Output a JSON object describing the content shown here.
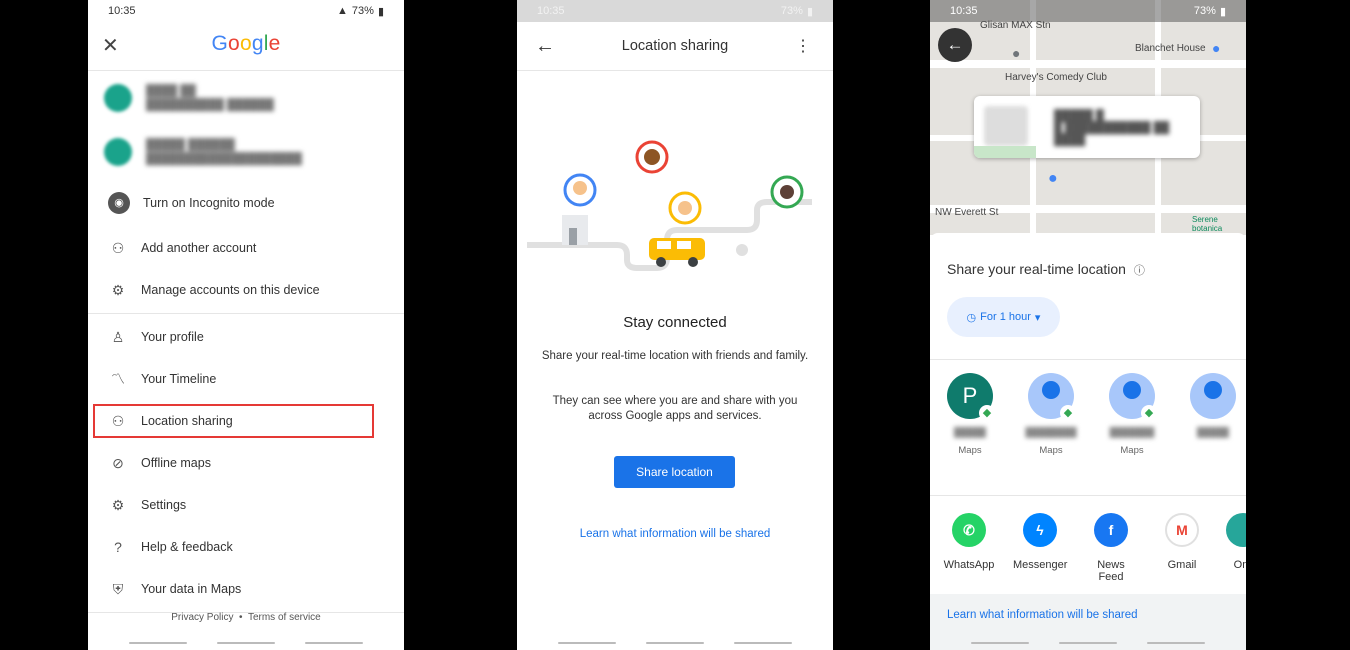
{
  "status": {
    "time": "10:35",
    "battery": "73%"
  },
  "screen1": {
    "brand": "Google",
    "menu": [
      {
        "label": "Turn on Incognito mode",
        "icon": "incognito-icon"
      },
      {
        "label": "Add another account",
        "icon": "person-add-icon"
      },
      {
        "label": "Manage accounts on this device",
        "icon": "manage-accounts-icon"
      },
      {
        "label": "Your profile",
        "icon": "person-icon"
      },
      {
        "label": "Your Timeline",
        "icon": "timeline-icon"
      },
      {
        "label": "Location sharing",
        "icon": "location-sharing-icon"
      },
      {
        "label": "Offline maps",
        "icon": "offline-maps-icon"
      },
      {
        "label": "Settings",
        "icon": "gear-icon"
      },
      {
        "label": "Help & feedback",
        "icon": "help-icon"
      },
      {
        "label": "Your data in Maps",
        "icon": "shield-icon"
      }
    ],
    "footer": {
      "privacy": "Privacy Policy",
      "sep": "•",
      "terms": "Terms of service"
    }
  },
  "screen2": {
    "title": "Location sharing",
    "heading": "Stay connected",
    "para1": "Share your real-time location with friends and family.",
    "para2": "They can see where you are and share with you across Google apps and services.",
    "button": "Share location",
    "link": "Learn what information will be shared"
  },
  "screen3": {
    "map_labels": [
      "Glisan MAX Stn",
      "Blanchet House",
      "Harvey's Comedy Club",
      "NW Everett St",
      "Serene botanica"
    ],
    "sheet_title": "Share your real-time location",
    "duration": "For 1 hour",
    "contacts": [
      {
        "initial": "P",
        "sub": "Maps"
      },
      {
        "initial": "",
        "sub": "Maps"
      },
      {
        "initial": "",
        "sub": "Maps"
      },
      {
        "initial": "",
        "sub": ""
      }
    ],
    "apps": [
      {
        "label": "WhatsApp",
        "color": "#25d366",
        "icon": "whatsapp-icon"
      },
      {
        "label": "Messenger",
        "color": "#0084ff",
        "icon": "messenger-icon"
      },
      {
        "label": "News Feed",
        "color": "#1877f2",
        "icon": "facebook-icon"
      },
      {
        "label": "Gmail",
        "color": "#ea4335",
        "icon": "gmail-icon"
      },
      {
        "label": "On",
        "color": "#26a69a",
        "icon": "app-icon"
      }
    ],
    "footer_link": "Learn what information will be shared"
  },
  "colors": {
    "accent": "#1a73e8",
    "highlight": "#e53935"
  }
}
